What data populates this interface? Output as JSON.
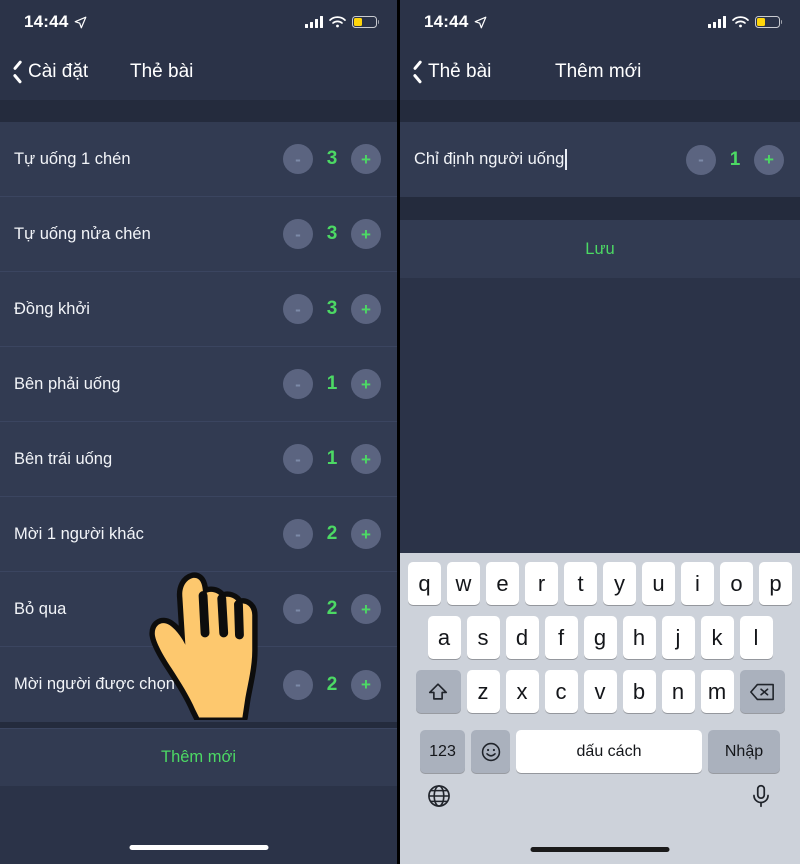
{
  "status_bar": {
    "time": "14:44",
    "location_icon": "location-arrow-icon",
    "signal_icon": "cellular-signal-icon",
    "wifi_icon": "wifi-icon",
    "battery_icon": "battery-low-icon",
    "battery_color": "#ffd60a"
  },
  "colors": {
    "accent_green": "#4cd964",
    "screen_bg": "#2b3348",
    "row_bg": "#323b52",
    "band_bg": "#242b3d",
    "stepper_bg": "#5b6480",
    "keyboard_bg": "#cdd2da",
    "hand_fill": "#fdc86e"
  },
  "left_screen": {
    "back_label": "Cài đặt",
    "title": "Thẻ bài",
    "rows": [
      {
        "label": "Tự uống 1 chén",
        "value": "3"
      },
      {
        "label": "Tự uống nửa chén",
        "value": "3"
      },
      {
        "label": "Đồng khởi",
        "value": "3"
      },
      {
        "label": "Bên phải uống",
        "value": "1"
      },
      {
        "label": "Bên trái uống",
        "value": "1"
      },
      {
        "label": "Mời 1 người khác",
        "value": "2"
      },
      {
        "label": "Bỏ qua",
        "value": "2"
      },
      {
        "label": "Mời người được chọn",
        "value": "2"
      }
    ],
    "minus_label": "-",
    "plus_label": "+",
    "action_label": "Thêm mới",
    "cursor_icon": "pointing-hand-cursor"
  },
  "right_screen": {
    "back_label": "Thẻ bài",
    "title": "Thêm mới",
    "input_value": "Chỉ định người uống",
    "input_placeholder": "Chỉ định người uống",
    "count_value": "1",
    "minus_label": "-",
    "plus_label": "+",
    "save_label": "Lưu",
    "cursor_icon": "pointing-hand-cursor"
  },
  "keyboard": {
    "row1": [
      "q",
      "w",
      "e",
      "r",
      "t",
      "y",
      "u",
      "i",
      "o",
      "p"
    ],
    "row2": [
      "a",
      "s",
      "d",
      "f",
      "g",
      "h",
      "j",
      "k",
      "l"
    ],
    "row3": [
      "z",
      "x",
      "c",
      "v",
      "b",
      "n",
      "m"
    ],
    "shift_icon": "shift-arrow-icon",
    "backspace_icon": "backspace-icon",
    "numbers_label": "123",
    "emoji_icon": "emoji-smiley-icon",
    "space_label": "dấu cách",
    "enter_label": "Nhập",
    "globe_icon": "globe-language-icon",
    "mic_icon": "microphone-icon"
  }
}
